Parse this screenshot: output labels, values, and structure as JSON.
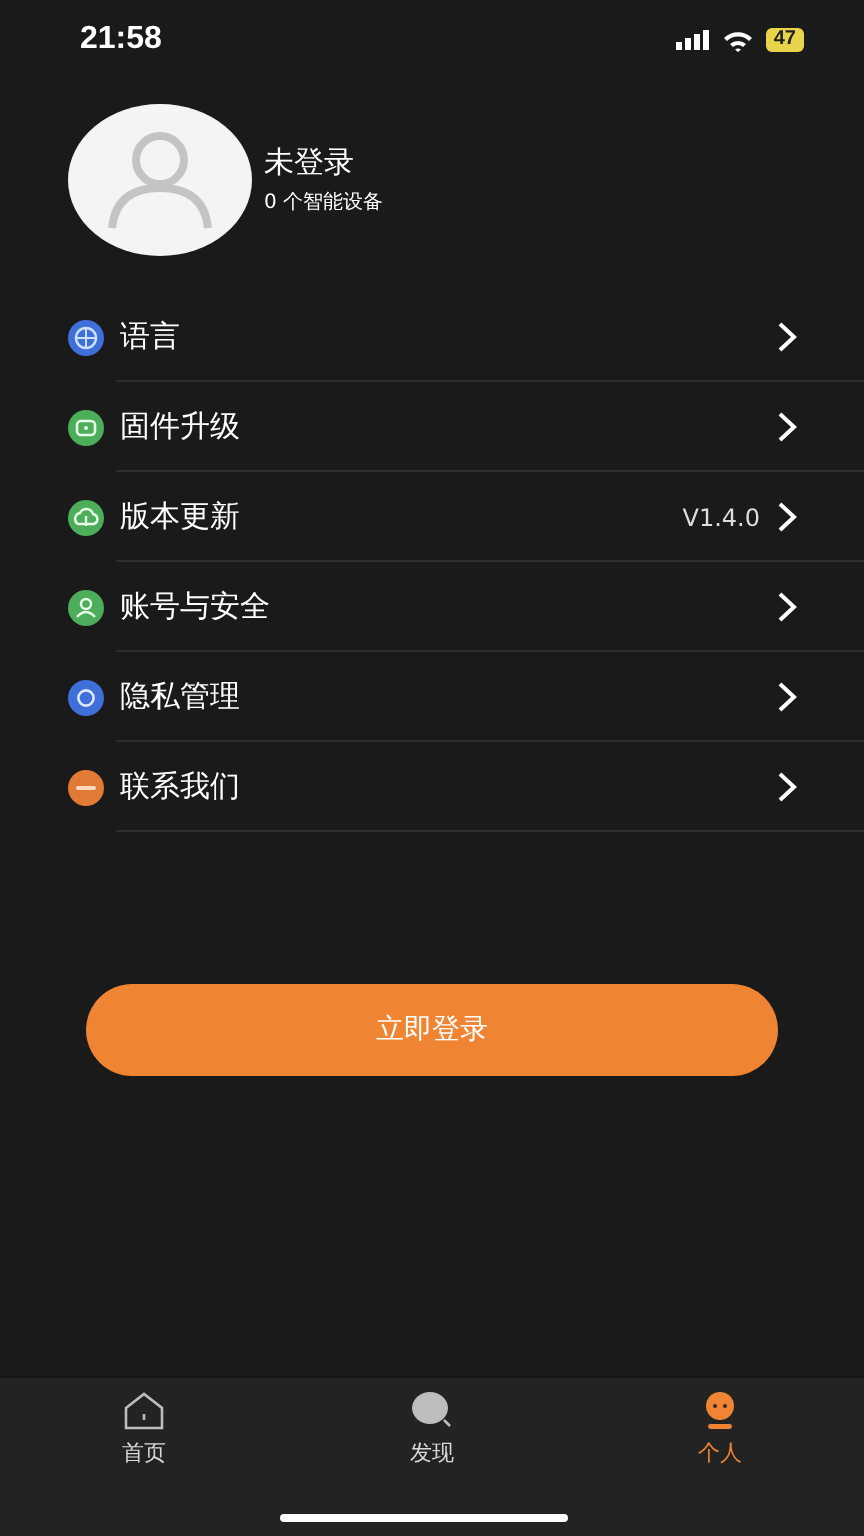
{
  "status_bar": {
    "time": "21:58",
    "battery": "47"
  },
  "profile": {
    "name": "未登录",
    "devices": "0 个智能设备"
  },
  "menu": [
    {
      "label": "语言",
      "color": "#3f6fd8"
    },
    {
      "label": "固件升级",
      "color": "#4cae5a"
    },
    {
      "label": "版本更新",
      "color": "#4cae5a",
      "value": "V1.4.0"
    },
    {
      "label": "账号与安全",
      "color": "#4cae5a"
    },
    {
      "label": "隐私管理",
      "color": "#3f6fd8"
    },
    {
      "label": "联系我们",
      "color": "#e07a35"
    }
  ],
  "login_button": "立即登录",
  "tabs": [
    {
      "label": "首页",
      "selected": false
    },
    {
      "label": "发现",
      "selected": false
    },
    {
      "label": "个人",
      "selected": true
    }
  ]
}
